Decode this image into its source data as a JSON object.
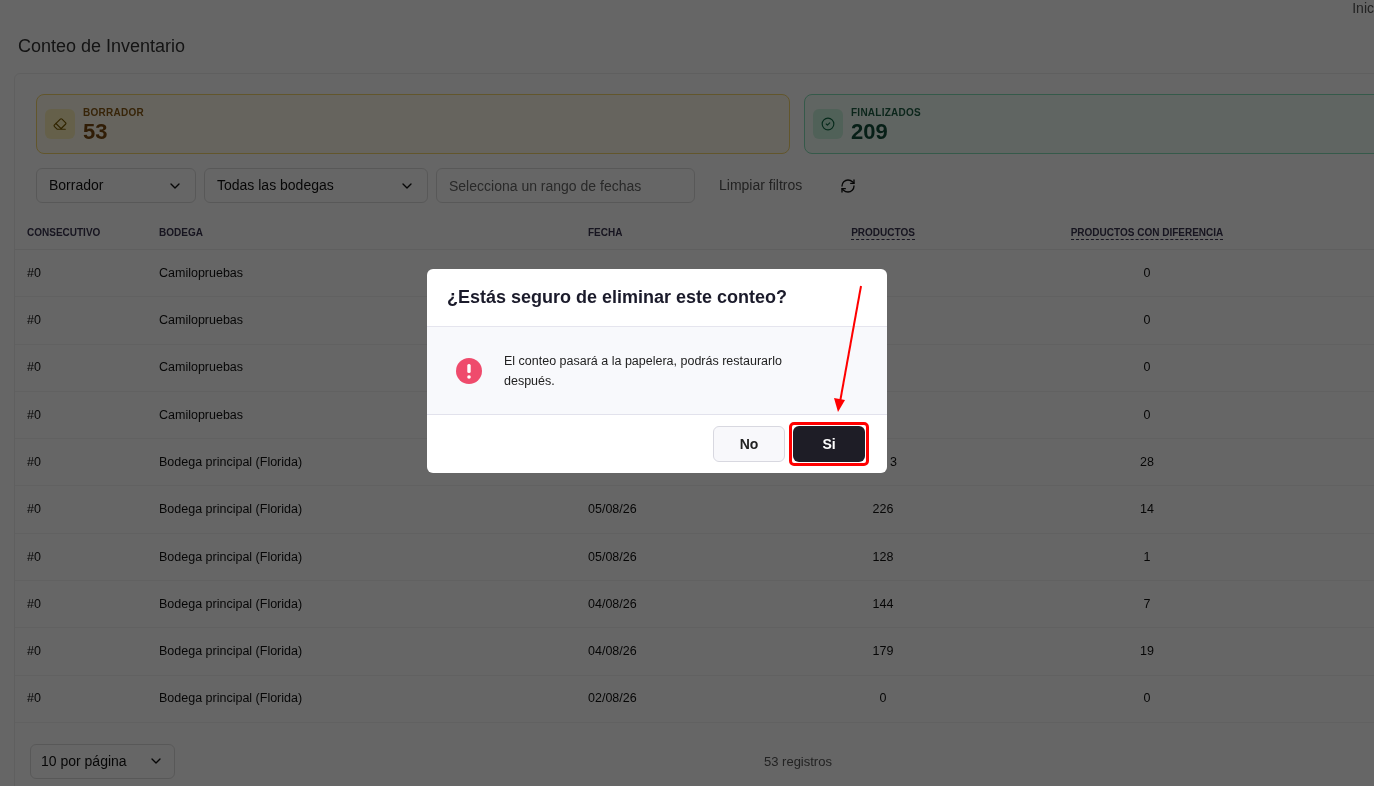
{
  "top_link": "Inic",
  "title": "Conteo de Inventario",
  "stats": [
    {
      "kind": "draft",
      "label": "BORRADOR",
      "value": "53"
    },
    {
      "kind": "done",
      "label": "FINALIZADOS",
      "value": "209"
    }
  ],
  "filters": {
    "status": "Borrador",
    "warehouse": "Todas las bodegas",
    "date_placeholder": "Selecciona un rango de fechas",
    "clear": "Limpiar filtros"
  },
  "table": {
    "columns": [
      {
        "label": "CONSECUTIVO",
        "sortable": false
      },
      {
        "label": "BODEGA",
        "sortable": false
      },
      {
        "label": "FECHA",
        "sortable": false
      },
      {
        "label": "PRODUCTOS",
        "sortable": true
      },
      {
        "label": "PRODUCTOS CON DIFERENCIA",
        "sortable": true
      }
    ],
    "rows": [
      {
        "consecutivo": "#0",
        "bodega": "Camilopruebas",
        "diferencia": "0"
      },
      {
        "consecutivo": "#0",
        "bodega": "Camilopruebas",
        "diferencia": "0"
      },
      {
        "consecutivo": "#0",
        "bodega": "Camilopruebas",
        "diferencia": "0"
      },
      {
        "consecutivo": "#0",
        "bodega": "Camilopruebas",
        "diferencia": "0"
      },
      {
        "consecutivo": "#0",
        "bodega": "Bodega principal (Florida)",
        "productos": {
          "text": "3",
          "cut": true
        },
        "diferencia": "28"
      },
      {
        "consecutivo": "#0",
        "bodega": "Bodega principal (Florida)",
        "fecha": "05/08/26",
        "productos": {
          "text": "226",
          "cut": false
        },
        "diferencia": "14"
      },
      {
        "consecutivo": "#0",
        "bodega": "Bodega principal (Florida)",
        "fecha": "05/08/26",
        "productos": {
          "text": "128",
          "cut": false
        },
        "diferencia": "1"
      },
      {
        "consecutivo": "#0",
        "bodega": "Bodega principal (Florida)",
        "fecha": "04/08/26",
        "productos": {
          "text": "144",
          "cut": false
        },
        "diferencia": "7"
      },
      {
        "consecutivo": "#0",
        "bodega": "Bodega principal (Florida)",
        "fecha": "04/08/26",
        "productos": {
          "text": "179",
          "cut": false
        },
        "diferencia": "19"
      },
      {
        "consecutivo": "#0",
        "bodega": "Bodega principal (Florida)",
        "fecha": "02/08/26",
        "productos": {
          "text": "0",
          "cut": false
        },
        "diferencia": "0"
      }
    ]
  },
  "footer": {
    "page_size": "10 por página",
    "count": "53 registros"
  },
  "dialog": {
    "title": "¿Estás seguro de eliminar este conteo?",
    "message": "El conteo pasará a la papelera, podrás restaurarlo después.",
    "buttons": [
      {
        "kind": "secondary",
        "label": "No",
        "highlighted": false
      },
      {
        "kind": "primary",
        "label": "Si",
        "highlighted": true
      }
    ]
  }
}
